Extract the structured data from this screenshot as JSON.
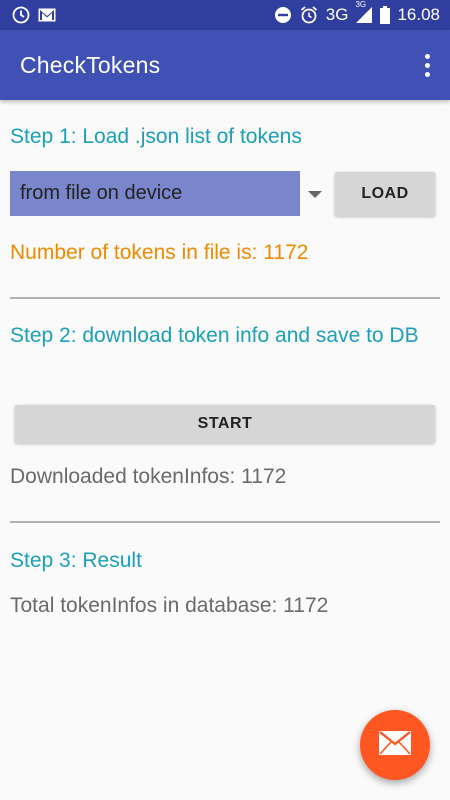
{
  "status_bar": {
    "network": "3G",
    "network_super": "3G",
    "time": "16.08",
    "icons": [
      "clock-icon",
      "gmail-icon",
      "do-not-disturb-icon",
      "alarm-icon",
      "signal-icon",
      "battery-icon"
    ]
  },
  "app_bar": {
    "title": "CheckTokens",
    "overflow_icon": "more-vert-icon",
    "color": "#3f51b5"
  },
  "step1": {
    "title": "Step 1: Load .json list of tokens",
    "source_select": {
      "value": "from file on device"
    },
    "load_button": "LOAD",
    "count_text": "Number of tokens in file is:  1172"
  },
  "step2": {
    "title": "Step 2: download token info and save to DB",
    "start_button": "START",
    "downloaded_text": "Downloaded tokenInfos: 1172"
  },
  "step3": {
    "title": "Step 3: Result",
    "total_text": "Total tokenInfos in database: 1172"
  },
  "fab": {
    "icon": "mail-icon",
    "color": "#ff5722"
  },
  "colors": {
    "accent_teal": "#1ba0b8",
    "orange_text": "#ef8a00",
    "dropdown_bg": "#7986cb"
  }
}
